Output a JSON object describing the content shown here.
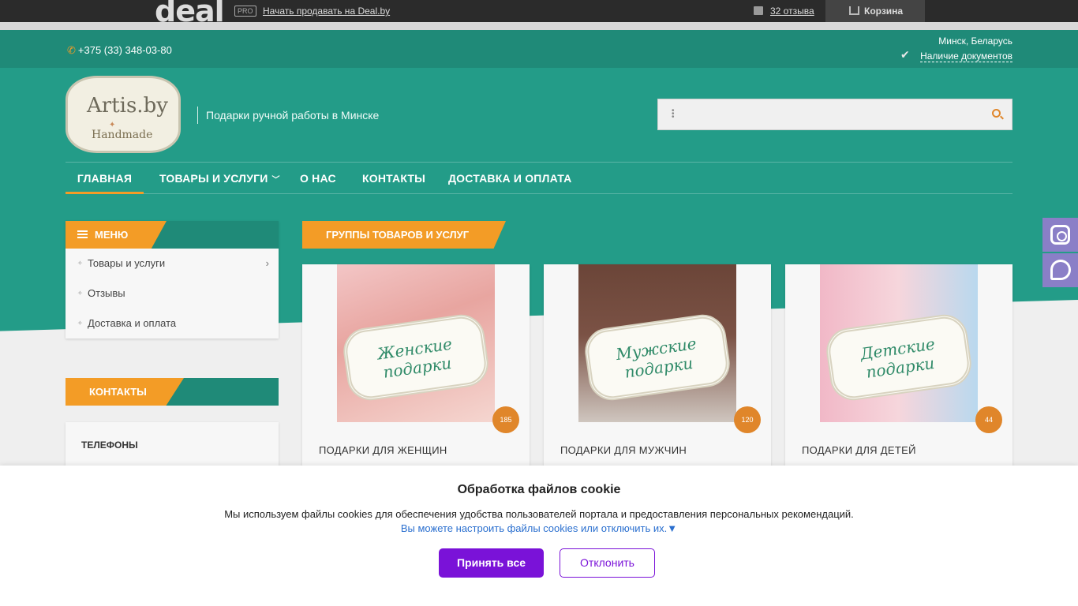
{
  "dealbar": {
    "logo": "deal",
    "pro_badge": "PRO",
    "sell_link": "Начать продавать на Deal.by",
    "reviews_link": "32 отзыва",
    "cart_label": "Корзина"
  },
  "infobar": {
    "phone": "+375 (33) 348-03-80",
    "city": "Минск, Беларусь",
    "documents": "Наличие документов"
  },
  "header": {
    "logo_text": "Artis.by",
    "logo_subtext": "Handmade",
    "tagline": "Подарки ручной работы в Минске"
  },
  "nav": {
    "items": [
      {
        "label": "Главная"
      },
      {
        "label": "Товары и услуги"
      },
      {
        "label": "О нас"
      },
      {
        "label": "Контакты"
      },
      {
        "label": "Доставка и оплата"
      }
    ]
  },
  "sidebar": {
    "menu_title": "Меню",
    "items": [
      {
        "label": "Товары и услуги"
      },
      {
        "label": "Отзывы"
      },
      {
        "label": "Доставка и оплата"
      }
    ],
    "contacts_title": "Контакты",
    "phones_label": "Телефоны"
  },
  "groups": {
    "title": "Группы товаров и услуг",
    "cards": [
      {
        "title": "Подарки для женщин",
        "count": "185",
        "image_text_1": "Женские",
        "image_text_2": "подарки"
      },
      {
        "title": "Подарки для мужчин",
        "count": "120",
        "image_text_1": "Мужские",
        "image_text_2": "подарки"
      },
      {
        "title": "Подарки для детей",
        "count": "44",
        "image_text_1": "Детские",
        "image_text_2": "подарки"
      }
    ]
  },
  "cookie": {
    "title": "Обработка файлов cookie",
    "text": "Мы используем файлы cookies для обеспечения удобства пользователей портала и предоставления персональных рекомендаций.",
    "settings_link": "Вы можете настроить файлы cookies или отключить их.▼",
    "accept_label": "Принять все",
    "decline_label": "Отклонить"
  },
  "icons": {
    "phone": "phone-icon",
    "check": "check-icon",
    "search": "search-icon",
    "cart": "cart-icon",
    "reviews": "comment-icon",
    "instagram": "instagram-icon",
    "viber": "viber-icon"
  },
  "colors": {
    "teal": "#239c88",
    "teal_dark": "#1f8a78",
    "orange": "#f39c26",
    "purple": "#7a12d8",
    "social": "#8a7fc7"
  }
}
